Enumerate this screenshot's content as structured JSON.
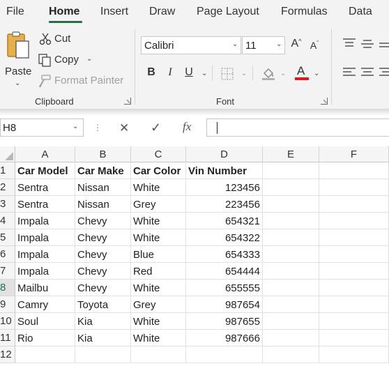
{
  "ribbon_tabs": [
    "File",
    "Home",
    "Insert",
    "Draw",
    "Page Layout",
    "Formulas",
    "Data"
  ],
  "clipboard": {
    "paste_label": "Paste",
    "cut_label": "Cut",
    "copy_label": "Copy",
    "format_painter_label": "Format Painter",
    "group_label": "Clipboard"
  },
  "font": {
    "font_name": "Calibri",
    "font_size": "11",
    "group_label": "Font",
    "font_color": "#e81123"
  },
  "formula_bar": {
    "name_box": "H8",
    "cancel_glyph": "✕",
    "enter_glyph": "✓",
    "fx_label": "fx",
    "formula_value": ""
  },
  "sheet": {
    "column_headers": [
      "A",
      "B",
      "C",
      "D",
      "E",
      "F"
    ],
    "row_headers": [
      "1",
      "2",
      "3",
      "4",
      "5",
      "6",
      "7",
      "8",
      "9",
      "10",
      "11",
      "12"
    ],
    "selected_row": "8",
    "rows": [
      [
        "Car Model",
        "Car Make",
        "Car Color",
        "Vin Number",
        "",
        ""
      ],
      [
        "Sentra",
        "Nissan",
        "White",
        "123456",
        "",
        ""
      ],
      [
        "Sentra",
        "Nissan",
        "Grey",
        "223456",
        "",
        ""
      ],
      [
        "Impala",
        "Chevy",
        "White",
        "654321",
        "",
        ""
      ],
      [
        "Impala",
        "Chevy",
        "White",
        "654322",
        "",
        ""
      ],
      [
        "Impala",
        "Chevy",
        "Blue",
        "654333",
        "",
        ""
      ],
      [
        "Impala",
        "Chevy",
        "Red",
        "654444",
        "",
        ""
      ],
      [
        "Mailbu",
        "Chevy",
        "White",
        "655555",
        "",
        ""
      ],
      [
        "Camry",
        "Toyota",
        "Grey",
        "987654",
        "",
        ""
      ],
      [
        "Soul",
        "Kia",
        "White",
        "987655",
        "",
        ""
      ],
      [
        "Rio",
        "Kia",
        "White",
        "987666",
        "",
        ""
      ],
      [
        "",
        "",
        "",
        "",
        "",
        ""
      ]
    ]
  },
  "colors": {
    "accent": "#217346",
    "ribbon_bg": "#f3f3f3"
  }
}
